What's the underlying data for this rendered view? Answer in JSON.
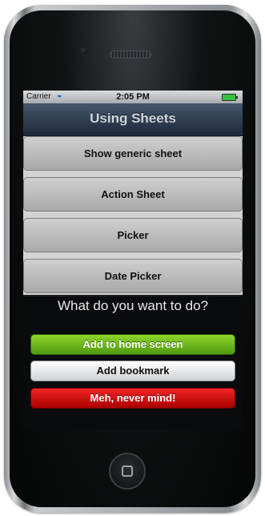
{
  "status_bar": {
    "carrier": "Carrier",
    "time": "2:05 PM",
    "wifi_icon": "wifi-icon",
    "battery_icon": "battery-icon"
  },
  "navbar": {
    "title": "Using Sheets"
  },
  "list": {
    "items": [
      {
        "label": "Show generic sheet"
      },
      {
        "label": "Action Sheet"
      },
      {
        "label": "Picker"
      },
      {
        "label": "Date Picker"
      }
    ]
  },
  "action_sheet": {
    "question": "What do you want to do?",
    "buttons": [
      {
        "label": "Add to home screen",
        "color": "#6fb81e"
      },
      {
        "label": "Add bookmark",
        "color": "#eeeeee"
      },
      {
        "label": "Meh, never mind!",
        "color": "#d40000"
      }
    ]
  }
}
